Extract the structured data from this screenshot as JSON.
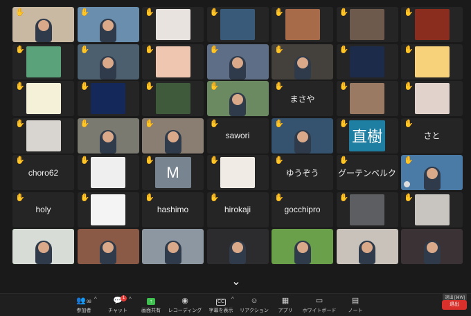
{
  "tiles": [
    {
      "type": "video",
      "hand": true,
      "bg": "#c9b9a3"
    },
    {
      "type": "video",
      "hand": true,
      "bg": "#6a8fae"
    },
    {
      "type": "image",
      "hand": true,
      "bg": "#e8e3de"
    },
    {
      "type": "image",
      "hand": true,
      "bg": "#3a5a7a"
    },
    {
      "type": "image",
      "hand": true,
      "bg": "#a86b4a"
    },
    {
      "type": "image",
      "hand": true,
      "bg": "#6d5a4c"
    },
    {
      "type": "image",
      "hand": true,
      "bg": "#8a2d1f"
    },
    {
      "type": "image",
      "hand": true,
      "bg": "#5aa37a"
    },
    {
      "type": "video",
      "hand": true,
      "bg": "#4b5f6e"
    },
    {
      "type": "image",
      "hand": true,
      "bg": "#efc7b0"
    },
    {
      "type": "video",
      "hand": true,
      "bg": "#5e6e86"
    },
    {
      "type": "video",
      "hand": true,
      "bg": "#44403c"
    },
    {
      "type": "image",
      "hand": true,
      "bg": "#1d2b4a"
    },
    {
      "type": "image",
      "hand": true,
      "bg": "#f7d27a"
    },
    {
      "type": "image",
      "hand": true,
      "bg": "#f5f1d8"
    },
    {
      "type": "image",
      "hand": true,
      "bg": "#14285a"
    },
    {
      "type": "image",
      "hand": true,
      "bg": "#3e5a3a"
    },
    {
      "type": "video",
      "hand": true,
      "bg": "#6b8a62"
    },
    {
      "type": "name",
      "hand": true,
      "name_key": "masaya"
    },
    {
      "type": "image",
      "hand": true,
      "bg": "#9a7a62"
    },
    {
      "type": "image",
      "hand": true,
      "bg": "#e2d2cc"
    },
    {
      "type": "image",
      "hand": true,
      "bg": "#d8d4d0"
    },
    {
      "type": "video",
      "hand": true,
      "bg": "#7a7a70"
    },
    {
      "type": "video",
      "hand": true,
      "bg": "#8a7e72"
    },
    {
      "type": "name",
      "hand": true,
      "name_key": "sawori"
    },
    {
      "type": "video",
      "hand": true,
      "bg": "#35536e"
    },
    {
      "type": "letter",
      "hand": true,
      "letter_key": "naoki",
      "bg": "#1e7fa3"
    },
    {
      "type": "name",
      "hand": true,
      "name_key": "sato"
    },
    {
      "type": "name",
      "hand": true,
      "name_key": "choro62"
    },
    {
      "type": "image",
      "hand": true,
      "bg": "#efefef"
    },
    {
      "type": "letter",
      "hand": true,
      "letter_key": "m",
      "bg": "#788591"
    },
    {
      "type": "image",
      "hand": true,
      "bg": "#f0ebe4"
    },
    {
      "type": "name",
      "hand": true,
      "name_key": "yuuzou"
    },
    {
      "type": "name",
      "hand": true,
      "name_key": "gutenberg"
    },
    {
      "type": "video",
      "hand": true,
      "mic": true,
      "bg": "#4a7aa6"
    },
    {
      "type": "name",
      "hand": true,
      "name_key": "holy"
    },
    {
      "type": "image",
      "hand": true,
      "bg": "#f4f4f4"
    },
    {
      "type": "name",
      "hand": true,
      "name_key": "hashimo"
    },
    {
      "type": "name",
      "hand": true,
      "name_key": "hirokaji"
    },
    {
      "type": "name",
      "hand": true,
      "name_key": "gocchipro"
    },
    {
      "type": "image",
      "hand": true,
      "bg": "#5d5e62"
    },
    {
      "type": "image",
      "hand": true,
      "bg": "#c8c4bf"
    },
    {
      "type": "video",
      "hand": false,
      "active": true,
      "bg": "#d7dcd6"
    },
    {
      "type": "video",
      "hand": false,
      "bg": "#8a5a46"
    },
    {
      "type": "video",
      "hand": false,
      "bg": "#8d97a1"
    },
    {
      "type": "video",
      "hand": false,
      "bg": "#2c2c2e"
    },
    {
      "type": "video",
      "hand": false,
      "bg": "#6aa04a"
    },
    {
      "type": "video",
      "hand": false,
      "bg": "#c9c2bb"
    },
    {
      "type": "video",
      "hand": false,
      "bg": "#3a3235"
    }
  ],
  "names": {
    "masaya": "まさや",
    "sawori": "sawori",
    "sato": "さと",
    "choro62": "choro62",
    "yuuzou": "ゆうぞう",
    "gutenberg": "グーテンベルク",
    "holy": "holy",
    "hashimo": "hashimo",
    "hirokaji": "hirokaji",
    "gocchipro": "gocchipro"
  },
  "letters": {
    "naoki": "直樹",
    "m": "M"
  },
  "toolbar": {
    "participants": {
      "label": "参加者",
      "icon": "people-icon",
      "count": "98"
    },
    "chat": {
      "label": "チャット",
      "icon": "chat-icon",
      "badge": "1"
    },
    "share": {
      "label": "画面共有",
      "icon": "share-icon"
    },
    "record": {
      "label": "レコーディング",
      "icon": "record-icon"
    },
    "captions": {
      "label": "字幕を表示",
      "icon": "cc-icon",
      "icon_text": "CC"
    },
    "reactions": {
      "label": "リアクション",
      "icon": "reaction-icon"
    },
    "apps": {
      "label": "アプリ",
      "icon": "apps-icon"
    },
    "whiteboard": {
      "label": "ホワイトボード",
      "icon": "whiteboard-icon"
    },
    "notes": {
      "label": "ノート",
      "icon": "notes-icon"
    },
    "leave_tip": "退出 [⌘W]",
    "leave": "退出"
  },
  "colors": {
    "share_green": "#3fbf4f",
    "leave_red": "#d9302c",
    "active_border": "#5bd15b",
    "hand_yellow": "#f2c94c"
  }
}
